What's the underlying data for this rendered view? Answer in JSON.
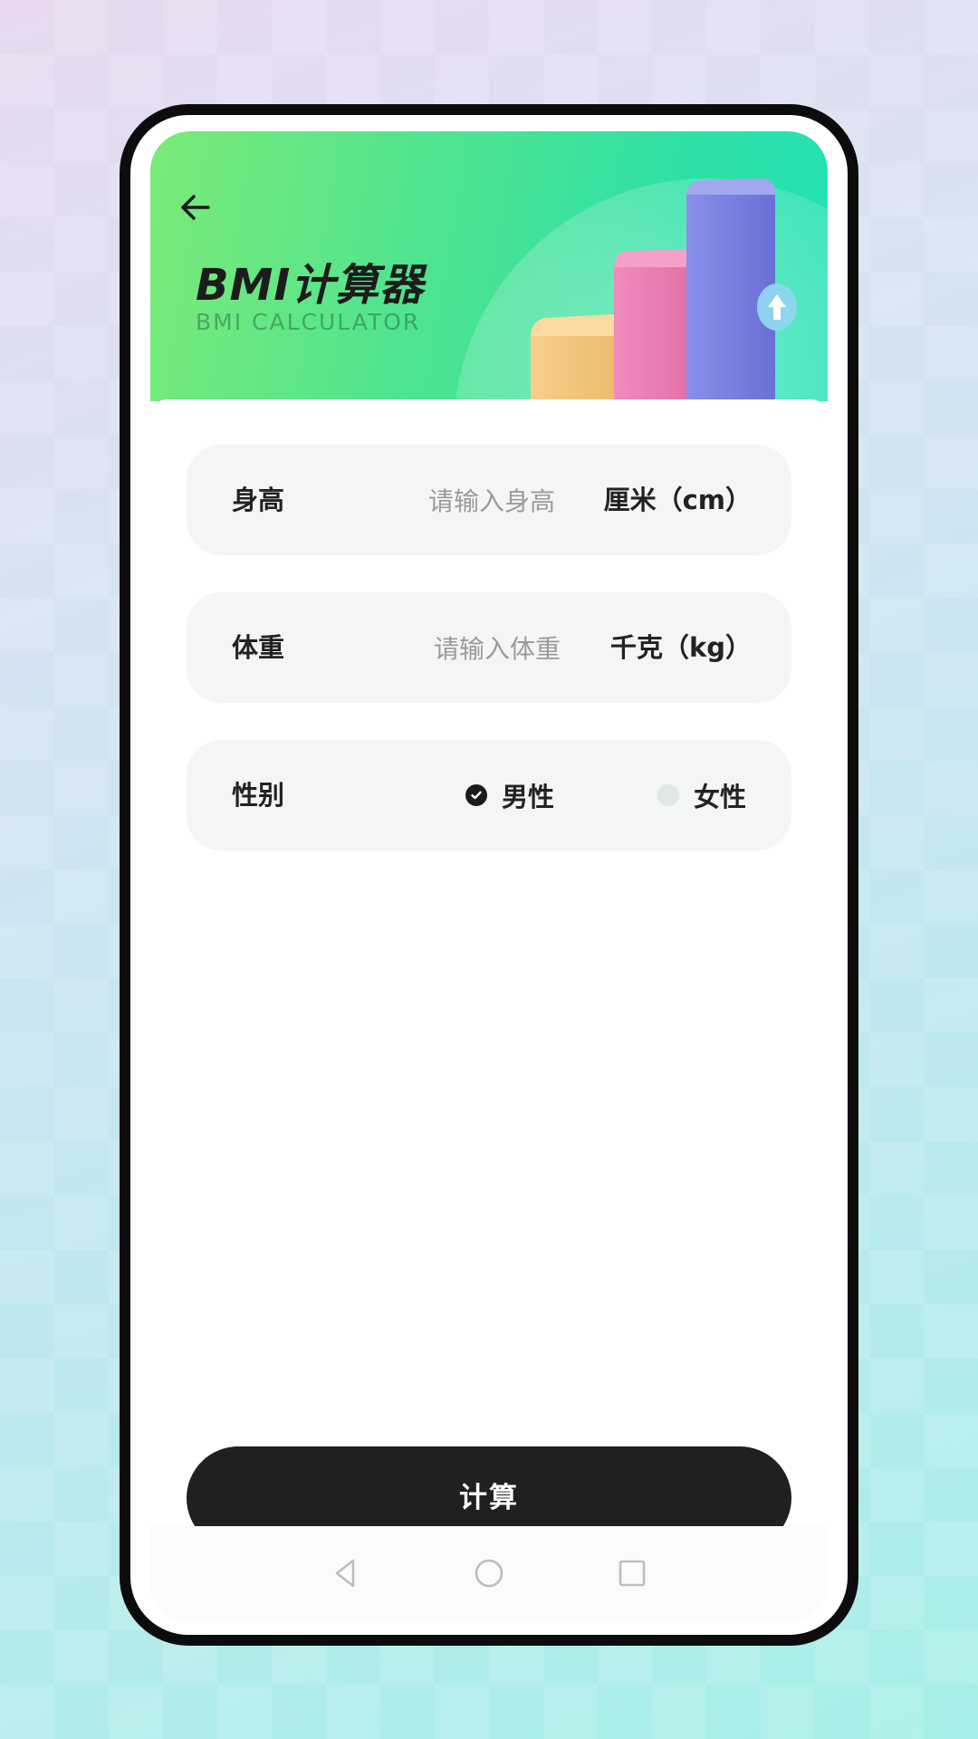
{
  "header": {
    "title": "BMI计算器",
    "subtitle": "BMI CALCULATOR"
  },
  "form": {
    "height": {
      "label": "身高",
      "placeholder": "请输入身高",
      "value": "",
      "unit": "厘米（cm）"
    },
    "weight": {
      "label": "体重",
      "placeholder": "请输入体重",
      "value": "",
      "unit": "千克（kg）"
    },
    "gender": {
      "label": "性别",
      "options": [
        {
          "label": "男性",
          "selected": true
        },
        {
          "label": "女性",
          "selected": false
        }
      ]
    }
  },
  "actions": {
    "calculate_label": "计算"
  },
  "icons": {
    "back": "arrow-left-icon",
    "nav_back": "triangle-back-icon",
    "nav_home": "circle-home-icon",
    "nav_recents": "square-recents-icon"
  },
  "colors": {
    "hero_start": "#7bea78",
    "hero_end": "#22e2b5",
    "button_bg": "#1f2020",
    "field_bg": "#f4f5f5",
    "bar_yellow": "#f2c77c",
    "bar_pink": "#ec7fb2",
    "bar_purple": "#7a80e2"
  }
}
